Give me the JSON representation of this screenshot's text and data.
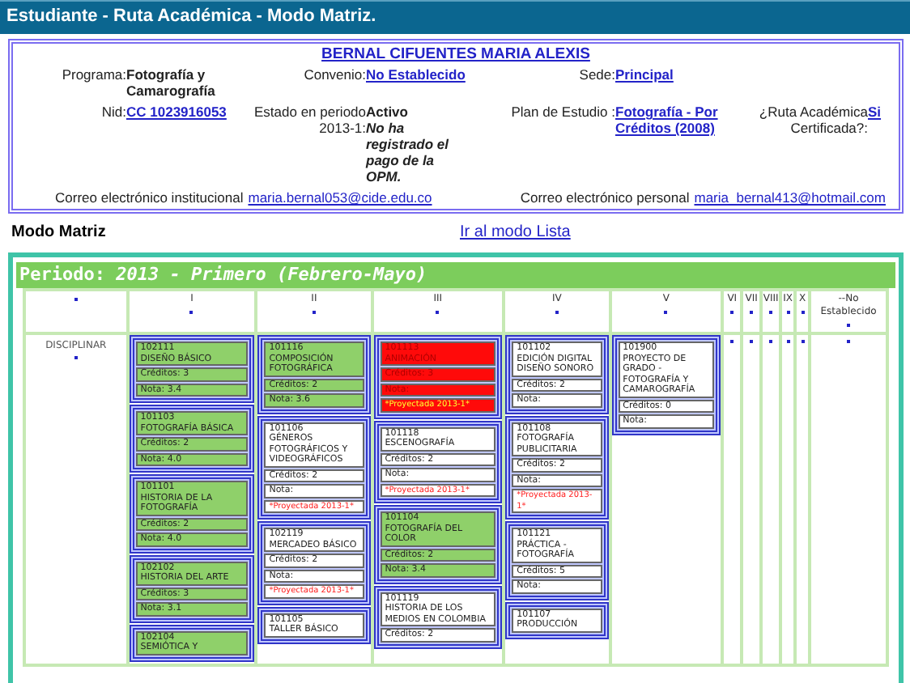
{
  "window": {
    "title": "Estudiante - Ruta Académica - Modo Matriz."
  },
  "student": {
    "name": "BERNAL CIFUENTES MARIA ALEXIS",
    "field_rows": [
      [
        {
          "label": "Programa:",
          "value": "Fotografía y Camarografía",
          "kind": "text"
        },
        {
          "label": "Convenio:",
          "value": "No Establecido",
          "kind": "link"
        },
        {
          "label": "Sede:",
          "value": "Principal",
          "kind": "link"
        }
      ],
      [
        {
          "label": "Nid:",
          "value": "CC 1023916053",
          "kind": "link"
        },
        {
          "label": "Estado en periodo 2013-1:",
          "value": "Activo",
          "note": "No ha registrado el pago de la OPM.",
          "kind": "text"
        },
        {
          "label": "Plan de Estudio :",
          "value": "Fotografía - Por Créditos (2008)",
          "kind": "link"
        },
        {
          "label": "¿Ruta Académica Certificada?:",
          "value": "Si",
          "kind": "link"
        }
      ]
    ],
    "emails": [
      {
        "label": "Correo electrónico institucional",
        "value": "maria.bernal053@cide.edu.co"
      },
      {
        "label": "Correo electrónico personal",
        "value": "maria_bernal413@hotmail.com"
      }
    ]
  },
  "view": {
    "title": "Modo Matriz",
    "link": "Ir al modo Lista"
  },
  "period": {
    "title": "Periodo: *2013 - Primero (Febrero-Mayo)*",
    "columns": [
      {
        "label": "I"
      },
      {
        "label": "II"
      },
      {
        "label": "III"
      },
      {
        "label": "IV"
      },
      {
        "label": "V"
      },
      {
        "label": "VI"
      },
      {
        "label": "VII"
      },
      {
        "label": "VIII"
      },
      {
        "label": "IX"
      },
      {
        "label": "X"
      },
      {
        "label": "--No Establecido"
      }
    ],
    "rows": [
      {
        "label": "DISCIPLINAR",
        "cells": [
          [
            {
              "kind": "approved",
              "code": "102111",
              "name": "DISEÑO BÁSICO",
              "credits": "Créditos: 3",
              "grade": "Nota: 3.4"
            },
            {
              "kind": "approved",
              "code": "101103",
              "name": "FOTOGRAFÍA BÁSICA",
              "credits": "Créditos: 2",
              "grade": "Nota: 4.0"
            },
            {
              "kind": "approved",
              "code": "101101",
              "name": "HISTORIA DE LA FOTOGRAFÍA",
              "credits": "Créditos: 2",
              "grade": "Nota: 4.0"
            },
            {
              "kind": "approved",
              "code": "102102",
              "name": "HISTORIA DEL ARTE",
              "credits": "Créditos: 3",
              "grade": "Nota: 3.1"
            },
            {
              "kind": "approved",
              "code": "102104",
              "name": "SEMIÓTICA Y"
            }
          ],
          [
            {
              "kind": "approved",
              "code": "101116",
              "name": "COMPOSICIÓN FOTOGRÁFICA",
              "credits": "Créditos: 2",
              "grade": "Nota: 3.6"
            },
            {
              "kind": "pending",
              "code": "101106",
              "name": "GÉNEROS FOTOGRÁFICOS Y VIDEOGRÁFICOS",
              "credits": "Créditos: 2",
              "grade": "Nota:",
              "note": "*Proyectada 2013-1*"
            },
            {
              "kind": "pending",
              "code": "102119",
              "name": "MERCADEO BÁSICO",
              "credits": "Créditos: 2",
              "grade": "Nota:",
              "note": "*Proyectada 2013-1*"
            },
            {
              "kind": "pending",
              "code": "101105",
              "name": "TALLER BÁSICO"
            }
          ],
          [
            {
              "kind": "failed",
              "code": "101113",
              "name": "ANIMACIÓN",
              "credits": "Créditos: 3",
              "grade": "Nota:",
              "note": "*Proyectada 2013-1*"
            },
            {
              "kind": "pending",
              "code": "101118",
              "name": "ESCENOGRAFÍA",
              "credits": "Créditos: 2",
              "grade": "Nota:",
              "note": "*Proyectada 2013-1*"
            },
            {
              "kind": "approved",
              "code": "101104",
              "name": "FOTOGRAFÍA DEL COLOR",
              "credits": "Créditos: 2",
              "grade": "Nota: 3.4"
            },
            {
              "kind": "pending",
              "code": "101119",
              "name": "HISTORIA DE LOS MEDIOS EN COLOMBIA",
              "credits": "Créditos: 2"
            }
          ],
          [
            {
              "kind": "pending",
              "code": "101102",
              "name": "EDICIÓN DIGITAL DISEÑO SONORO",
              "credits": "Créditos: 2",
              "grade": "Nota:"
            },
            {
              "kind": "pending",
              "code": "101108",
              "name": "FOTOGRAFÍA PUBLICITARIA",
              "credits": "Créditos: 2",
              "grade": "Nota:",
              "note": "*Proyectada 2013-1*"
            },
            {
              "kind": "pending",
              "code": "101121",
              "name": "PRÁCTICA - FOTOGRAFÍA",
              "credits": "Créditos: 5",
              "grade": "Nota:"
            },
            {
              "kind": "pending",
              "code": "101107",
              "name": "PRODUCCIÓN"
            }
          ],
          [
            {
              "kind": "pending",
              "code": "101900",
              "name": "PROYECTO DE GRADO - FOTOGRAFÍA Y CAMAROGRAFÍA",
              "credits": "Créditos: 0",
              "grade": "Nota:"
            }
          ],
          [],
          [],
          [],
          [],
          [],
          []
        ]
      }
    ]
  }
}
